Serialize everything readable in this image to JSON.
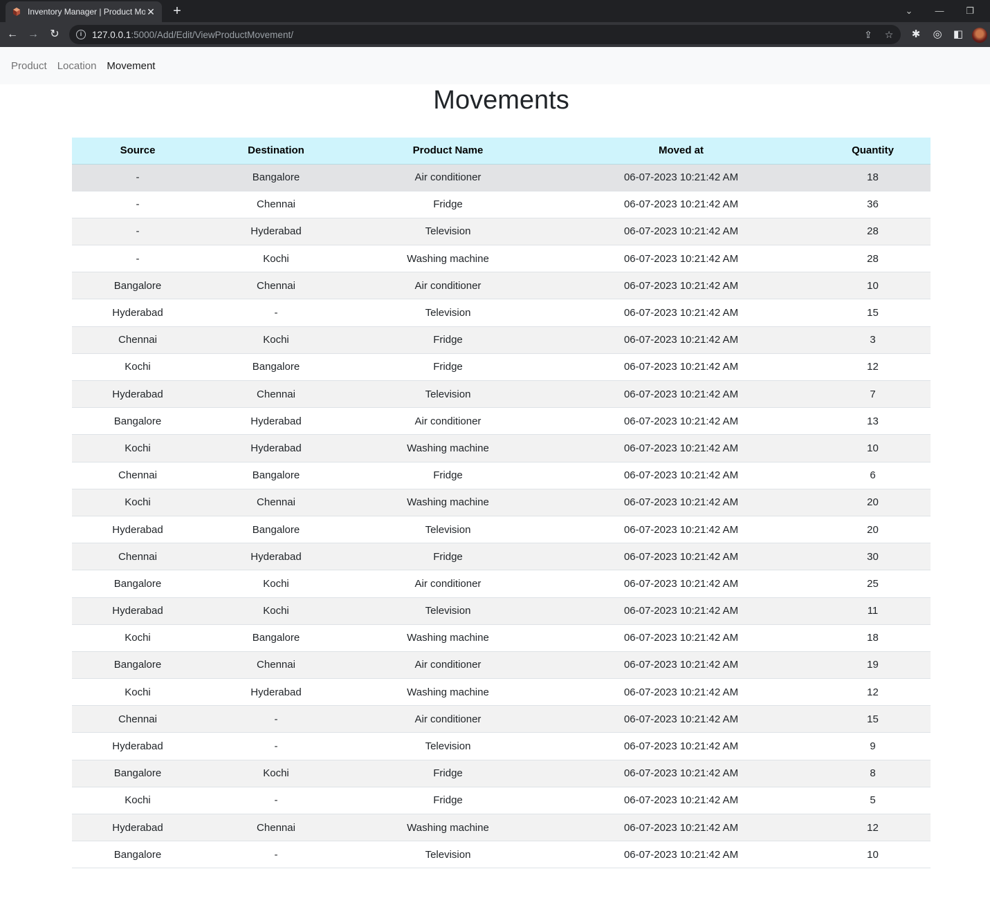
{
  "browser": {
    "tab_title": "Inventory Manager | Product Mo",
    "url_host": "127.0.0.1",
    "url_rest": ":5000/Add/Edit/ViewProductMovement/"
  },
  "nav": {
    "product": "Product",
    "location": "Location",
    "movement": "Movement"
  },
  "page_title": "Movements",
  "table": {
    "headers": [
      "Source",
      "Destination",
      "Product Name",
      "Moved at",
      "Quantity"
    ],
    "rows": [
      [
        "-",
        "Bangalore",
        "Air conditioner",
        "06-07-2023 10:21:42 AM",
        "18"
      ],
      [
        "-",
        "Chennai",
        "Fridge",
        "06-07-2023 10:21:42 AM",
        "36"
      ],
      [
        "-",
        "Hyderabad",
        "Television",
        "06-07-2023 10:21:42 AM",
        "28"
      ],
      [
        "-",
        "Kochi",
        "Washing machine",
        "06-07-2023 10:21:42 AM",
        "28"
      ],
      [
        "Bangalore",
        "Chennai",
        "Air conditioner",
        "06-07-2023 10:21:42 AM",
        "10"
      ],
      [
        "Hyderabad",
        "-",
        "Television",
        "06-07-2023 10:21:42 AM",
        "15"
      ],
      [
        "Chennai",
        "Kochi",
        "Fridge",
        "06-07-2023 10:21:42 AM",
        "3"
      ],
      [
        "Kochi",
        "Bangalore",
        "Fridge",
        "06-07-2023 10:21:42 AM",
        "12"
      ],
      [
        "Hyderabad",
        "Chennai",
        "Television",
        "06-07-2023 10:21:42 AM",
        "7"
      ],
      [
        "Bangalore",
        "Hyderabad",
        "Air conditioner",
        "06-07-2023 10:21:42 AM",
        "13"
      ],
      [
        "Kochi",
        "Hyderabad",
        "Washing machine",
        "06-07-2023 10:21:42 AM",
        "10"
      ],
      [
        "Chennai",
        "Bangalore",
        "Fridge",
        "06-07-2023 10:21:42 AM",
        "6"
      ],
      [
        "Kochi",
        "Chennai",
        "Washing machine",
        "06-07-2023 10:21:42 AM",
        "20"
      ],
      [
        "Hyderabad",
        "Bangalore",
        "Television",
        "06-07-2023 10:21:42 AM",
        "20"
      ],
      [
        "Chennai",
        "Hyderabad",
        "Fridge",
        "06-07-2023 10:21:42 AM",
        "30"
      ],
      [
        "Bangalore",
        "Kochi",
        "Air conditioner",
        "06-07-2023 10:21:42 AM",
        "25"
      ],
      [
        "Hyderabad",
        "Kochi",
        "Television",
        "06-07-2023 10:21:42 AM",
        "11"
      ],
      [
        "Kochi",
        "Bangalore",
        "Washing machine",
        "06-07-2023 10:21:42 AM",
        "18"
      ],
      [
        "Bangalore",
        "Chennai",
        "Air conditioner",
        "06-07-2023 10:21:42 AM",
        "19"
      ],
      [
        "Kochi",
        "Hyderabad",
        "Washing machine",
        "06-07-2023 10:21:42 AM",
        "12"
      ],
      [
        "Chennai",
        "-",
        "Air conditioner",
        "06-07-2023 10:21:42 AM",
        "15"
      ],
      [
        "Hyderabad",
        "-",
        "Television",
        "06-07-2023 10:21:42 AM",
        "9"
      ],
      [
        "Bangalore",
        "Kochi",
        "Fridge",
        "06-07-2023 10:21:42 AM",
        "8"
      ],
      [
        "Kochi",
        "-",
        "Fridge",
        "06-07-2023 10:21:42 AM",
        "5"
      ],
      [
        "Hyderabad",
        "Chennai",
        "Washing machine",
        "06-07-2023 10:21:42 AM",
        "12"
      ],
      [
        "Bangalore",
        "-",
        "Television",
        "06-07-2023 10:21:42 AM",
        "10"
      ]
    ]
  },
  "colors": {
    "table_header": "#cff4fc",
    "stripe": "#f2f2f2",
    "hover_row": "#e2e3e5",
    "navbar_bg": "#f8f9fa",
    "browser_frame": "#202124"
  }
}
